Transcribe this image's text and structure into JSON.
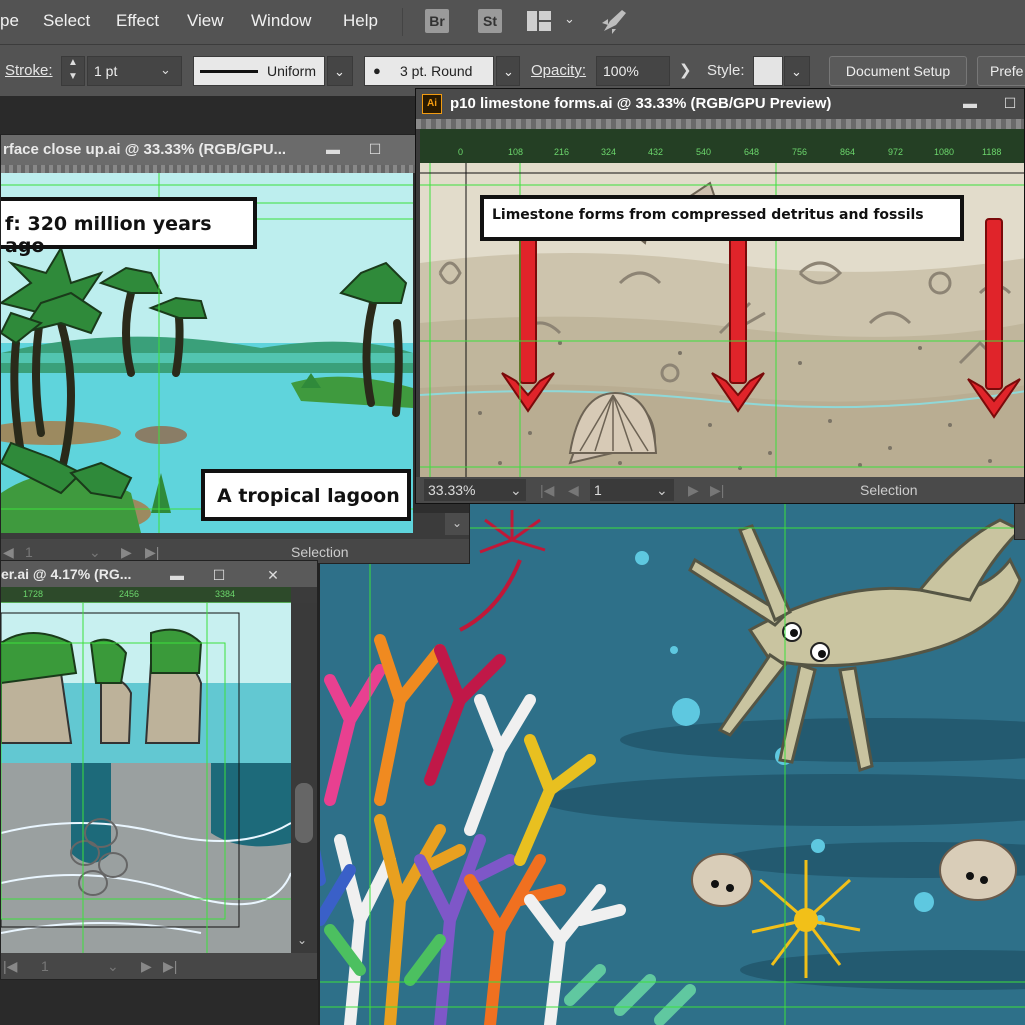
{
  "menu": {
    "items": [
      "pe",
      "Select",
      "Effect",
      "View",
      "Window",
      "Help"
    ],
    "bridge_br": "Br",
    "bridge_st": "St"
  },
  "control": {
    "stroke_label": "Stroke:",
    "stroke_value": "1 pt",
    "profile_label": "Uniform",
    "brush_label": "3 pt. Round",
    "opacity_label": "Opacity:",
    "opacity_value": "100%",
    "style_label": "Style:",
    "doc_setup": "Document Setup",
    "prefs": "Prefe"
  },
  "win_lagoon": {
    "title": "rface close up.ai @ 33.33% (RGB/GPU...",
    "caption_top": "f: 320 million years ago",
    "caption_bottom": "A tropical lagoon",
    "page": "1",
    "status": "Selection"
  },
  "win_limestone": {
    "title": "p10 limestone forms.ai @ 33.33% (RGB/GPU Preview)",
    "app_icon": "Ai",
    "caption": "Limestone forms from compressed detritus and fossils",
    "zoom": "33.33%",
    "page": "1",
    "status": "Selection",
    "ruler_ticks": [
      "0",
      "108",
      "216",
      "324",
      "432",
      "540",
      "648",
      "756",
      "864",
      "972",
      "1080",
      "1188"
    ]
  },
  "win_cave": {
    "title": "er.ai @ 4.17% (RG...",
    "page": "1",
    "ruler_ticks": [
      "1728",
      "2456",
      "3384"
    ]
  },
  "colors": {
    "menubar": "#535353",
    "reef_water": "#2f6f86",
    "lagoon_sky": "#b9efef",
    "arrow_red": "#e0242a",
    "guide_green": "#3ce03c"
  }
}
